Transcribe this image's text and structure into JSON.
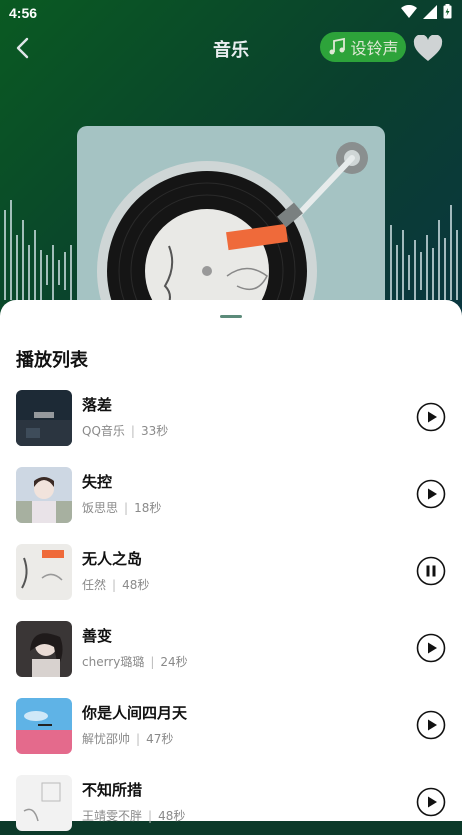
{
  "status": {
    "time": "4:56"
  },
  "header": {
    "title": "音乐",
    "ringtone_label": "设铃声"
  },
  "playlist": {
    "title": "播放列表",
    "songs": [
      {
        "name": "落差",
        "artist": "QQ音乐",
        "duration": "33秒",
        "state": "play"
      },
      {
        "name": "失控",
        "artist": "饭思思",
        "duration": "18秒",
        "state": "play"
      },
      {
        "name": "无人之岛",
        "artist": "任然",
        "duration": "48秒",
        "state": "pause"
      },
      {
        "name": "善变",
        "artist": "cherry璐璐",
        "duration": "24秒",
        "state": "play"
      },
      {
        "name": "你是人间四月天",
        "artist": "解忧邵帅",
        "duration": "47秒",
        "state": "play"
      },
      {
        "name": "不知所措",
        "artist": "王靖雯不胖",
        "duration": "48秒",
        "state": "play"
      }
    ],
    "separator": "|"
  },
  "colors": {
    "accent": "#2da33a",
    "background_start": "#0a5a22",
    "background_end": "#0a2f4f"
  },
  "icons": {
    "back": "chevron-left-icon",
    "heart": "heart-icon",
    "ringtone": "music-note-icon",
    "play": "play-icon",
    "pause": "pause-icon"
  }
}
